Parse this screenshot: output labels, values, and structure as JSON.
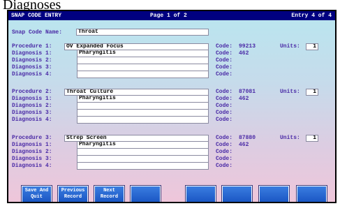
{
  "background_text": "Diagnoses",
  "window": {
    "title": "SNAP CODE ENTRY",
    "page": "Page 1 of 2",
    "entry": "Entry 4 of 4"
  },
  "snap_code": {
    "label": "Snap Code Name:",
    "value": "Throat"
  },
  "labels": {
    "diagnosis_1": "Diagnosis 1:",
    "diagnosis_2": "Diagnosis 2:",
    "diagnosis_3": "Diagnosis 3:",
    "diagnosis_4": "Diagnosis 4:",
    "code": "Code:",
    "units": "Units:"
  },
  "procedures": [
    {
      "label": "Procedure 1:",
      "name": "OV Expanded Focus",
      "code": "99213",
      "units": "1",
      "diagnosis_1": "Pharyngitis",
      "diagnosis_1_code": "462"
    },
    {
      "label": "Procedure 2:",
      "name": "Throat Culture",
      "code": "87081",
      "units": "1",
      "diagnosis_1": "Pharyngitis",
      "diagnosis_1_code": "462"
    },
    {
      "label": "Procedure 3:",
      "name": "Strep Screen",
      "code": "87880",
      "units": "1",
      "diagnosis_1": "Pharyngitis",
      "diagnosis_1_code": "462"
    }
  ],
  "buttons": {
    "save_line1": "Save And",
    "save_line2": "Quit",
    "prev_line1": "Previous",
    "prev_line2": "Record",
    "next_line1": "Next",
    "next_line2": "Record"
  }
}
